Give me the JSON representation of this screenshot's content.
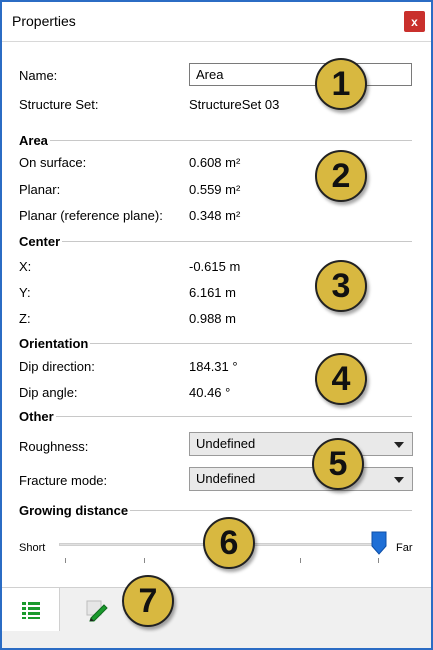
{
  "window": {
    "title": "Properties",
    "close_label": "x"
  },
  "general": {
    "name_label": "Name:",
    "name_value": "Area",
    "structure_set_label": "Structure Set:",
    "structure_set_value": "StructureSet 03"
  },
  "area": {
    "title": "Area",
    "on_surface_label": "On surface:",
    "on_surface_value": "0.608 m²",
    "planar_label": "Planar:",
    "planar_value": "0.559 m²",
    "planar_ref_label": "Planar (reference plane):",
    "planar_ref_value": "0.348 m²"
  },
  "center": {
    "title": "Center",
    "x_label": "X:",
    "x_value": "-0.615 m",
    "y_label": "Y:",
    "y_value": "6.161 m",
    "z_label": "Z:",
    "z_value": "0.988 m"
  },
  "orientation": {
    "title": "Orientation",
    "dip_direction_label": "Dip direction:",
    "dip_direction_value": "184.31 °",
    "dip_angle_label": "Dip angle:",
    "dip_angle_value": "40.46 °"
  },
  "other": {
    "title": "Other",
    "roughness_label": "Roughness:",
    "roughness_value": "Undefined",
    "fracture_mode_label": "Fracture mode:",
    "fracture_mode_value": "Undefined"
  },
  "growing": {
    "title": "Growing distance",
    "min_label": "Short",
    "max_label": "Far",
    "level_fraction": 1.0
  },
  "badges": [
    "1",
    "2",
    "3",
    "4",
    "5",
    "6",
    "7"
  ],
  "colors": {
    "accent": "#2b6cc4",
    "close": "#c9302c",
    "badge": "#d8b840",
    "thumb": "#1f6fd6",
    "tab_icon": "#1a9a2c"
  },
  "tabs": [
    {
      "icon": "list-icon",
      "active": true
    },
    {
      "icon": "pencil-icon",
      "active": false
    }
  ]
}
